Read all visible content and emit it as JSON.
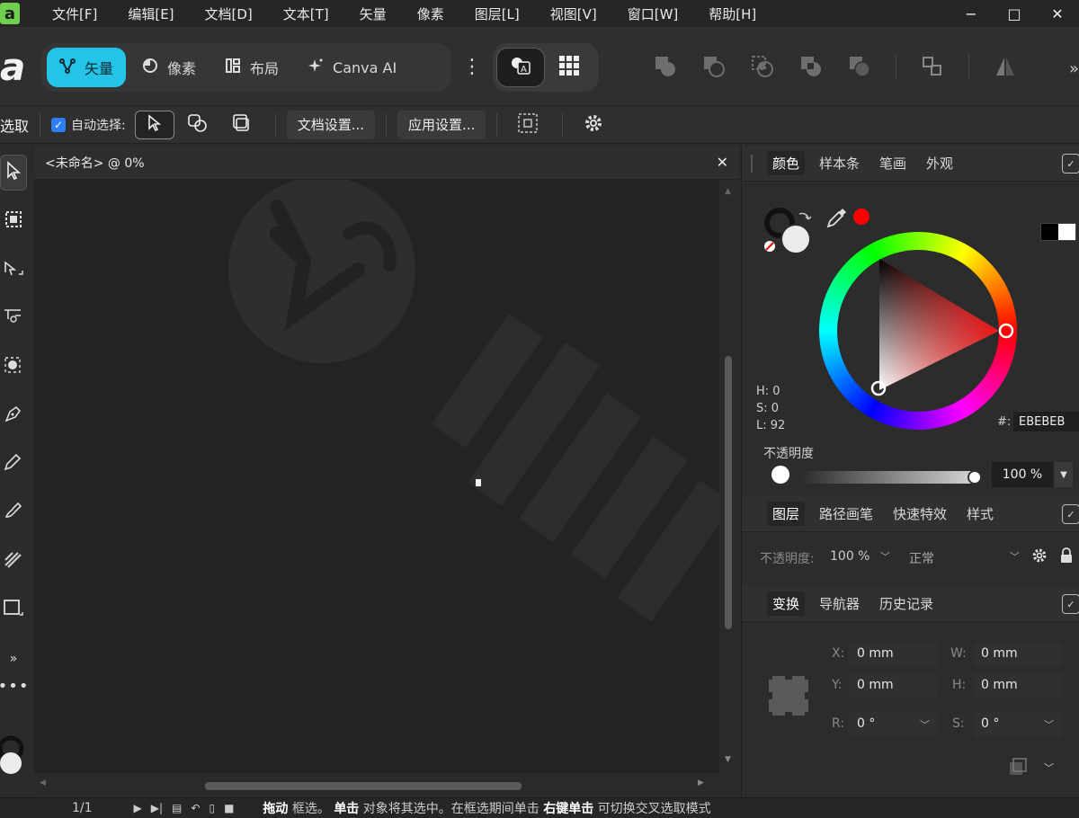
{
  "menubar": {
    "logo": "a",
    "items": [
      "文件[F]",
      "编辑[E]",
      "文档[D]",
      "文本[T]",
      "矢量",
      "像素",
      "图层[L]",
      "视图[V]",
      "窗口[W]",
      "帮助[H]"
    ],
    "minimize": "−",
    "maximize": "□",
    "close": "✕"
  },
  "toolbar": {
    "big_logo": "a",
    "personas": [
      {
        "label": "矢量",
        "icon": "vector-nodes-icon",
        "active": true
      },
      {
        "label": "像素",
        "icon": "pixel-circle-icon",
        "active": false
      },
      {
        "label": "布局",
        "icon": "layout-icon",
        "active": false
      },
      {
        "label": "Canva AI",
        "icon": "sparkle-icon",
        "active": false
      }
    ],
    "more": "⋮",
    "right_more": "»"
  },
  "context": {
    "tool_label": "选取",
    "auto_select_label": "自动选择:",
    "doc_settings": "文档设置...",
    "app_settings": "应用设置..."
  },
  "document": {
    "title": "<未命名> @ 0%",
    "close": "✕"
  },
  "color_panel": {
    "tabs": [
      "颜色",
      "样本条",
      "笔画",
      "外观"
    ],
    "active_tab": 0,
    "h_label": "H: 0",
    "s_label": "S: 0",
    "l_label": "L: 92",
    "hex_label": "#:",
    "hex_value": "EBEBEB",
    "opacity_label": "不透明度",
    "opacity_value": "100 %",
    "fill_color": "#ebebeb",
    "accent_red": "#ff0000"
  },
  "layers_panel": {
    "tabs": [
      "图层",
      "路径画笔",
      "快速特效",
      "样式"
    ],
    "active_tab": 0,
    "opacity_label": "不透明度:",
    "opacity_value": "100 %",
    "blend_mode": "正常"
  },
  "transform_panel": {
    "tabs": [
      "变换",
      "导航器",
      "历史记录"
    ],
    "active_tab": 0,
    "x_label": "X:",
    "x_value": "0 mm",
    "y_label": "Y:",
    "y_value": "0 mm",
    "w_label": "W:",
    "w_value": "0 mm",
    "h_label": "H:",
    "h_value": "0 mm",
    "r_label": "R:",
    "r_value": "0 °",
    "s_label": "S:",
    "s_value": "0 °"
  },
  "statusbar": {
    "page": "1/1",
    "hint_b1": "拖动",
    "hint_t1": "框选。",
    "hint_b2": "单击",
    "hint_t2": "对象将其选中。在框选期间单击",
    "hint_b3": "右键单击",
    "hint_t3": "可切换交叉选取模式"
  }
}
